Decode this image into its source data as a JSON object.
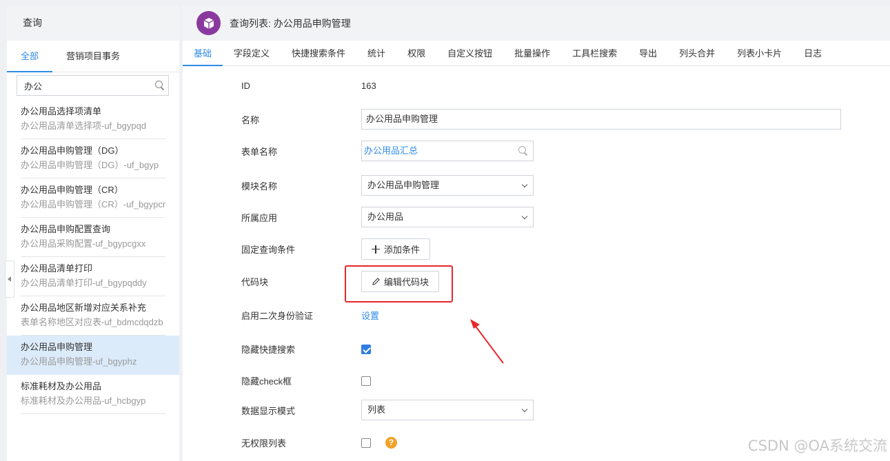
{
  "sidebar": {
    "header": "查询",
    "tabs": [
      {
        "label": "全部"
      },
      {
        "label": "营销项目事务"
      }
    ],
    "search_value": "办公",
    "items": [
      {
        "title": "办公用品选择项清单",
        "subtitle": "办公用品清单选择项-uf_bgypqd"
      },
      {
        "title": "办公用品申购管理（DG）",
        "subtitle": "办公用品申购管理（DG）-uf_bgyp"
      },
      {
        "title": "办公用品申购管理（CR）",
        "subtitle": "办公用品申购管理（CR）-uf_bgypcr"
      },
      {
        "title": "办公用品申购配置查询",
        "subtitle": "办公用品采购配置-uf_bgypcgxx"
      },
      {
        "title": "办公用品清单打印",
        "subtitle": "办公用品清单打印-uf_bgypqddy"
      },
      {
        "title": "办公用品地区新增对应关系补充",
        "subtitle": "表单名称地区对应表-uf_bdmcdqdzb"
      },
      {
        "title": "办公用品申购管理",
        "subtitle": "办公用品申购管理-uf_bgyphz"
      },
      {
        "title": "标准耗材及办公用品",
        "subtitle": "标准耗材及办公用品-uf_hcbgyp"
      }
    ]
  },
  "header": {
    "title": "查询列表: 办公用品申购管理"
  },
  "tabs": [
    {
      "label": "基础"
    },
    {
      "label": "字段定义"
    },
    {
      "label": "快捷搜索条件"
    },
    {
      "label": "统计"
    },
    {
      "label": "权限"
    },
    {
      "label": "自定义按钮"
    },
    {
      "label": "批量操作"
    },
    {
      "label": "工具栏搜索"
    },
    {
      "label": "导出"
    },
    {
      "label": "列头合并"
    },
    {
      "label": "列表小卡片"
    },
    {
      "label": "日志"
    }
  ],
  "form": {
    "id": {
      "label": "ID",
      "value": "163"
    },
    "name": {
      "label": "名称",
      "value": "办公用品申购管理"
    },
    "form_name": {
      "label": "表单名称",
      "value": "办公用品汇总"
    },
    "module": {
      "label": "模块名称",
      "value": "办公用品申购管理"
    },
    "app": {
      "label": "所属应用",
      "value": "办公用品"
    },
    "fixed_condition": {
      "label": "固定查询条件",
      "button": "添加条件"
    },
    "code_block": {
      "label": "代码块",
      "button": "编辑代码块"
    },
    "second_auth": {
      "label": "启用二次身份验证",
      "link": "设置"
    },
    "hide_quick_search": {
      "label": "隐藏快捷搜索",
      "checked": true
    },
    "hide_check": {
      "label": "隐藏check框",
      "checked": false
    },
    "display_mode": {
      "label": "数据显示模式",
      "value": "列表"
    },
    "no_permission_list": {
      "label": "无权限列表",
      "checked": false,
      "help": "?"
    }
  },
  "watermark": "CSDN @OA系统交流",
  "colors": {
    "accent": "#2f8be6",
    "highlight": "#e8262b",
    "logo": "#8a3a9f"
  }
}
